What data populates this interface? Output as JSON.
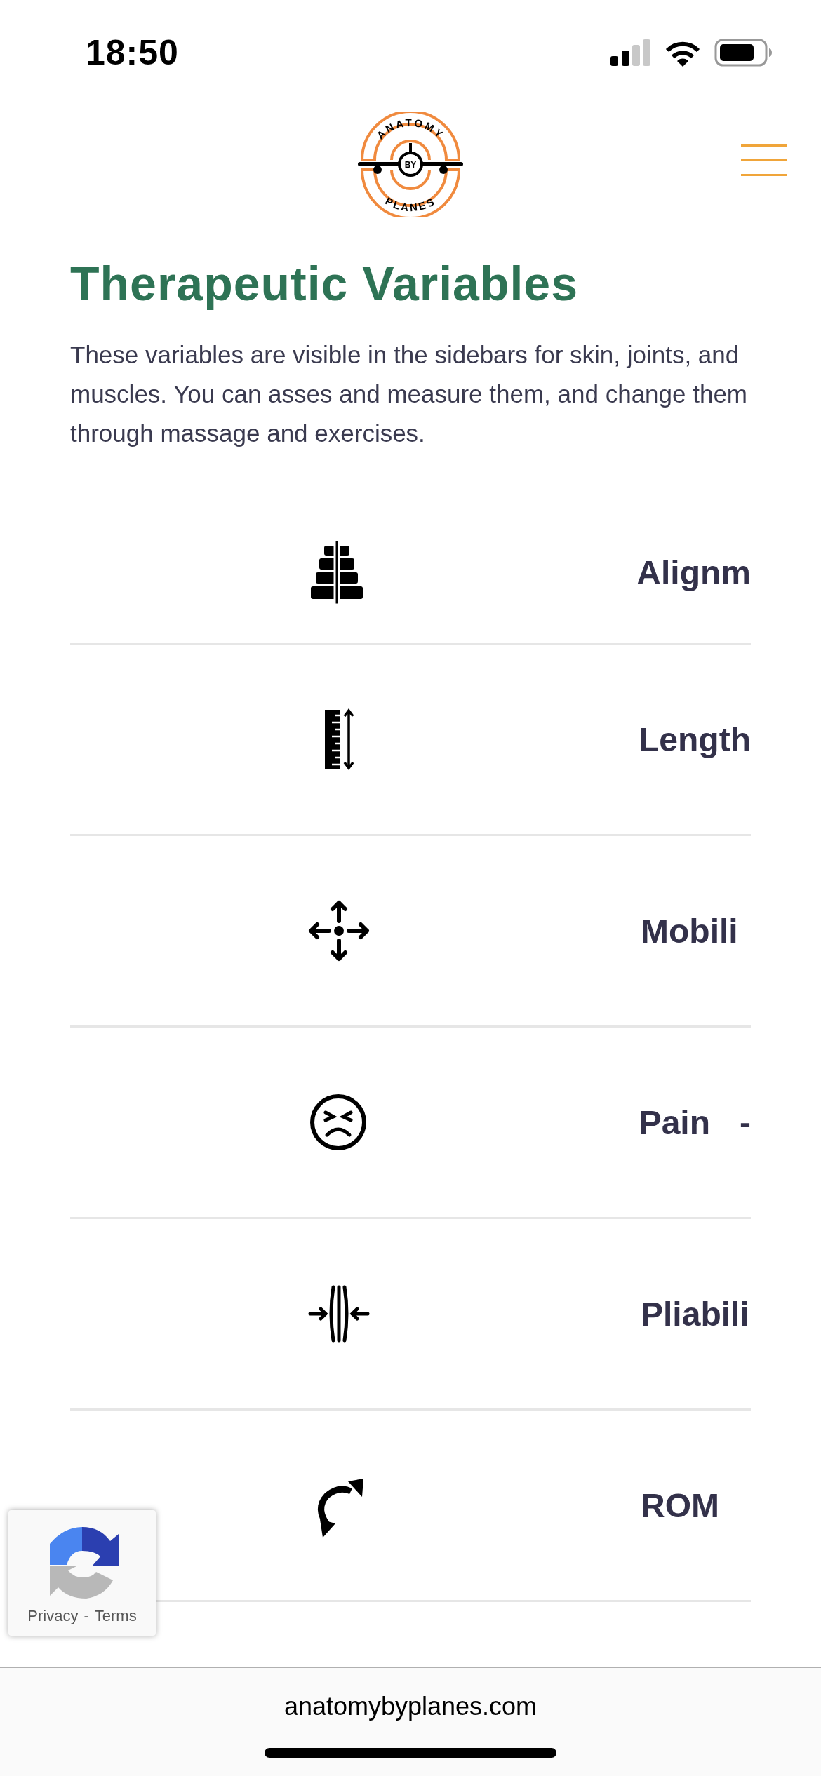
{
  "status_bar": {
    "time": "18:50"
  },
  "header": {
    "logo": {
      "top": "ANATOMY",
      "middle": "BY",
      "bottom": "PLANES"
    }
  },
  "title": "Therapeutic Variables",
  "intro": "These variables are visible in the sidebars for skin, joints, and muscles. You can asses and measure them, and change them through massage and exercises.",
  "variables": [
    {
      "kind": "alignment",
      "label": "Alignm"
    },
    {
      "kind": "length",
      "label": "Length"
    },
    {
      "kind": "mobility",
      "label": "Mobili"
    },
    {
      "kind": "pain",
      "label": "Pain",
      "extra": "-"
    },
    {
      "kind": "pliability",
      "label": "Pliabili"
    },
    {
      "kind": "rom",
      "label": "ROM"
    }
  ],
  "recaptcha": {
    "links": [
      "Privacy",
      "Terms"
    ],
    "separator": "-"
  },
  "browser_bar": {
    "url": "anatomybyplanes.com"
  }
}
